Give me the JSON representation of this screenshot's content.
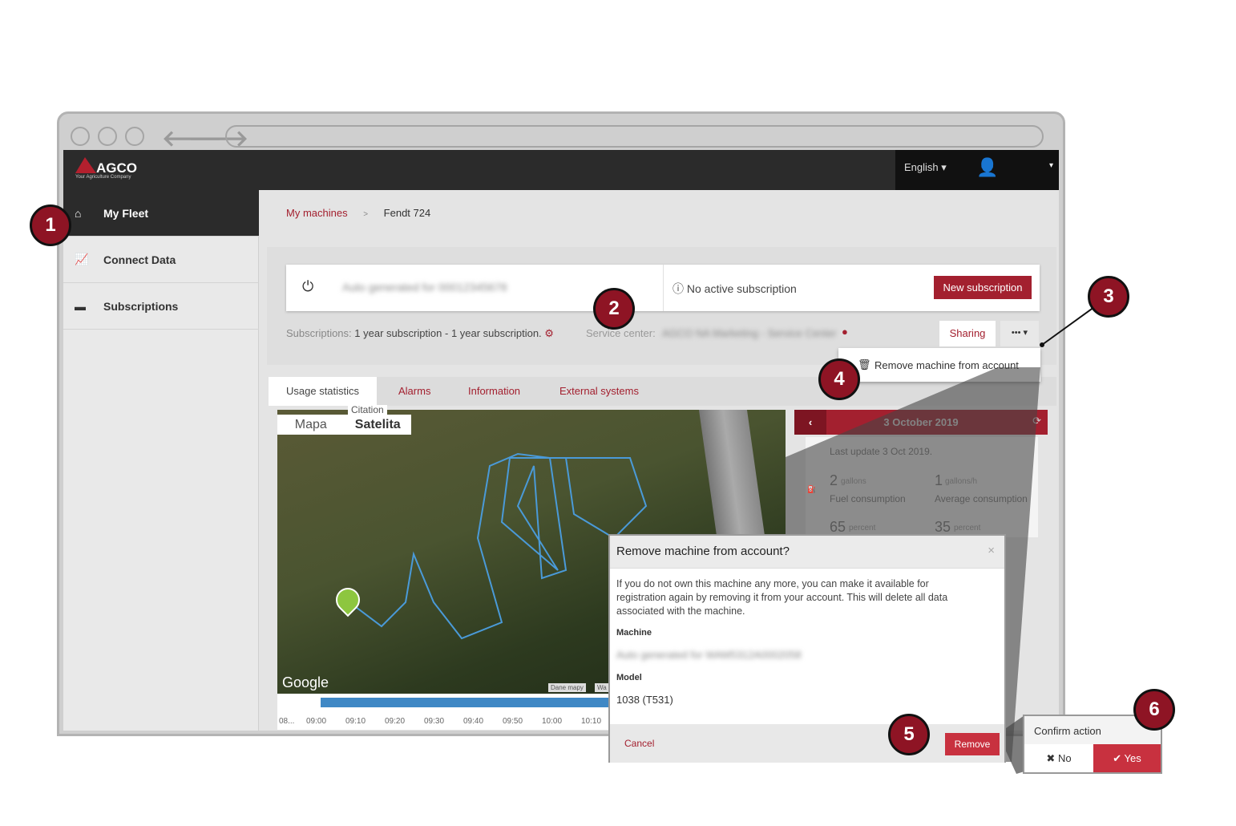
{
  "brand": {
    "logo": "AGCO",
    "tagline": "Your Agriculture Company",
    "accent": "#a3202f"
  },
  "header": {
    "language": "English"
  },
  "sidebar": {
    "items": [
      {
        "label": "My Fleet",
        "icon": "home-icon"
      },
      {
        "label": "Connect Data",
        "icon": "chart-icon"
      },
      {
        "label": "Subscriptions",
        "icon": "card-icon"
      }
    ]
  },
  "breadcrumb": {
    "parent": "My machines",
    "sep": ">",
    "current": "Fendt 724"
  },
  "machine": {
    "name": "Auto generated for 00012345678",
    "status": "No active subscription",
    "new_subscription": "New subscription",
    "subscriptions_label": "Subscriptions:",
    "subscriptions_value": "1 year subscription - 1 year subscription.",
    "service_center_label": "Service center:",
    "service_center_value": "AGCO NA Marketing - Service Center",
    "sharing": "Sharing",
    "more": "•••",
    "remove_item": "Remove machine from account"
  },
  "tabs": [
    "Usage statistics",
    "Alarms",
    "Information",
    "External systems"
  ],
  "map": {
    "types": [
      "Mapa",
      "Satelita"
    ],
    "google": "Google",
    "attribution": "Dane mapy",
    "attribution2": "Wa",
    "overlay_text": "Citation"
  },
  "timeline": [
    "08...",
    "09:00",
    "09:10",
    "09:20",
    "09:30",
    "09:40",
    "09:50",
    "10:00",
    "10:10"
  ],
  "stats": {
    "date": "3 October 2019",
    "last_update": "Last update 3 Oct 2019.",
    "items": [
      {
        "value": "2",
        "unit": "gallons",
        "label": "Fuel consumption"
      },
      {
        "value": "1",
        "unit": "gallons/h",
        "label": "Average consumption"
      },
      {
        "value": "65",
        "unit": "percent"
      },
      {
        "value": "35",
        "unit": "percent"
      }
    ]
  },
  "modal": {
    "title": "Remove machine from account?",
    "close": "×",
    "body": "If you do not own this machine any more, you can make it available for registration again by removing it from your account. This will delete all data associated with the machine.",
    "machine_label": "Machine",
    "machine_value": "Auto generated for WAM5312A0002058",
    "model_label": "Model",
    "model_value": "1038 (T531)",
    "cancel": "Cancel",
    "remove": "Remove"
  },
  "confirm": {
    "title": "Confirm action",
    "no": "No",
    "yes": "Yes"
  },
  "callouts": [
    "1",
    "2",
    "3",
    "4",
    "5",
    "6"
  ]
}
